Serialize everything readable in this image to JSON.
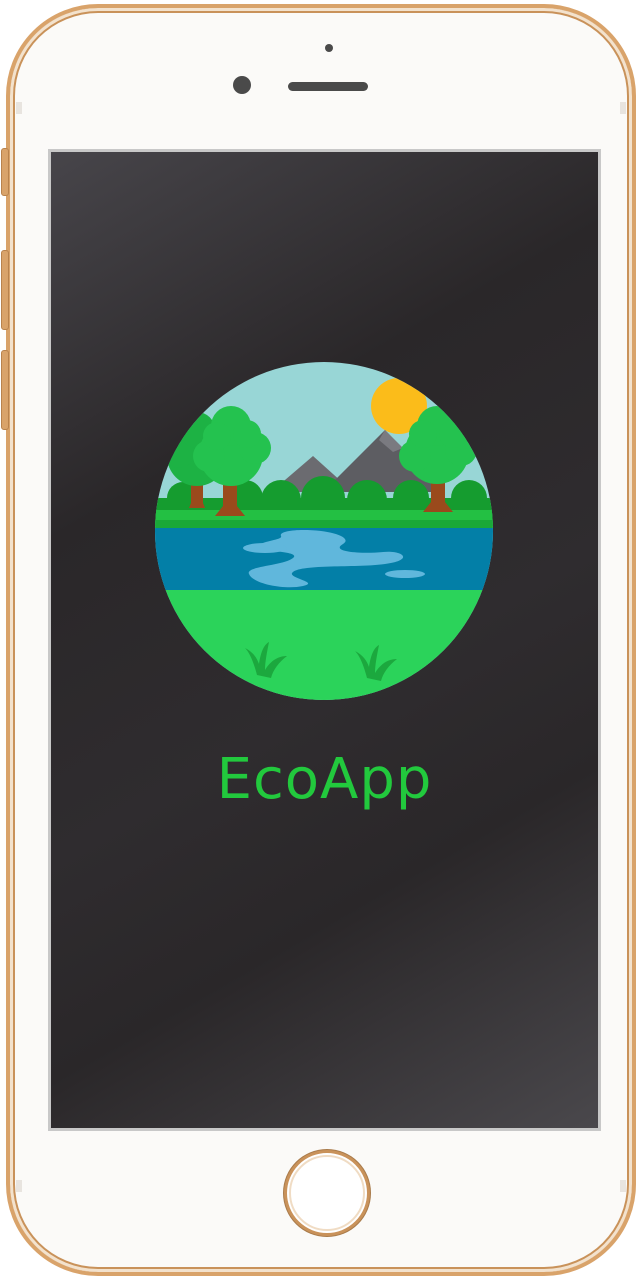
{
  "app": {
    "name": "EcoApp"
  },
  "splash": {
    "logo_icon": "nature-landscape-icon",
    "background": "#2d2a2d",
    "accent": "#22c93d"
  },
  "device": {
    "frame_color": "#d9a36a",
    "home_button_icon": "home-button"
  }
}
